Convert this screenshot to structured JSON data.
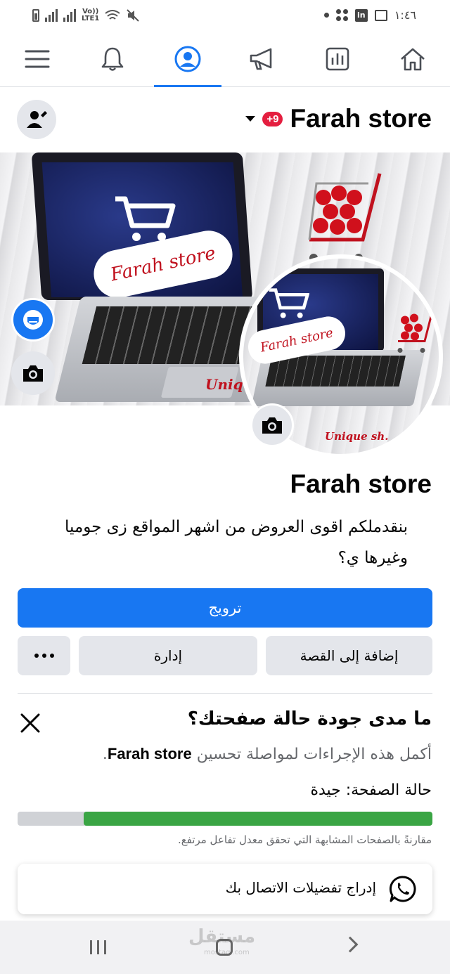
{
  "status_bar": {
    "network_label_top": "Vo))",
    "network_label_bottom": "LTE1",
    "linkedin_icon": "in",
    "time": "١:٤٦"
  },
  "top_nav": {
    "items": [
      {
        "name": "menu",
        "icon": "hamburger-icon",
        "active": false
      },
      {
        "name": "notifications",
        "icon": "bell-icon",
        "active": false
      },
      {
        "name": "profile",
        "icon": "profile-icon",
        "active": true
      },
      {
        "name": "promote",
        "icon": "megaphone-icon",
        "active": false
      },
      {
        "name": "insights",
        "icon": "bar-chart-icon",
        "active": false
      },
      {
        "name": "home",
        "icon": "home-icon",
        "active": false
      }
    ],
    "accent_color": "#1877f2"
  },
  "page_header": {
    "page_name": "Farah store",
    "notification_badge": "+9"
  },
  "cover": {
    "brand_text": "Farah store",
    "tagline": "Uniqu"
  },
  "profile_picture": {
    "brand_text": "Farah store",
    "tagline": "Unique sh."
  },
  "page_info": {
    "name": "Farah store",
    "bio": "بنقدملكم اقوى العروض من اشهر المواقع زى جوميا وغيرها ي؟"
  },
  "actions": {
    "promote_label": "ترويج",
    "add_to_story_label": "إضافة إلى القصة",
    "manage_label": "إدارة",
    "more_label": "···"
  },
  "page_health": {
    "title": "ما مدى جودة حالة صفحتك؟",
    "description_prefix": "أكمل هذه الإجراءات لمواصلة تحسين",
    "description_page": "Farah store",
    "description_suffix": ".",
    "status": "حالة الصفحة: جيدة",
    "progress": 0.84,
    "progress_color": "#3aa544",
    "note": "مقارنةً بالصفحات المشابهة التي تحقق معدل تفاعل مرتفع."
  },
  "contact_card": {
    "label": "إدراج تفضيلات الاتصال بك",
    "icon": "whatsapp-icon"
  },
  "watermark": {
    "text": "مستقل",
    "sub": "mostaql.com"
  }
}
